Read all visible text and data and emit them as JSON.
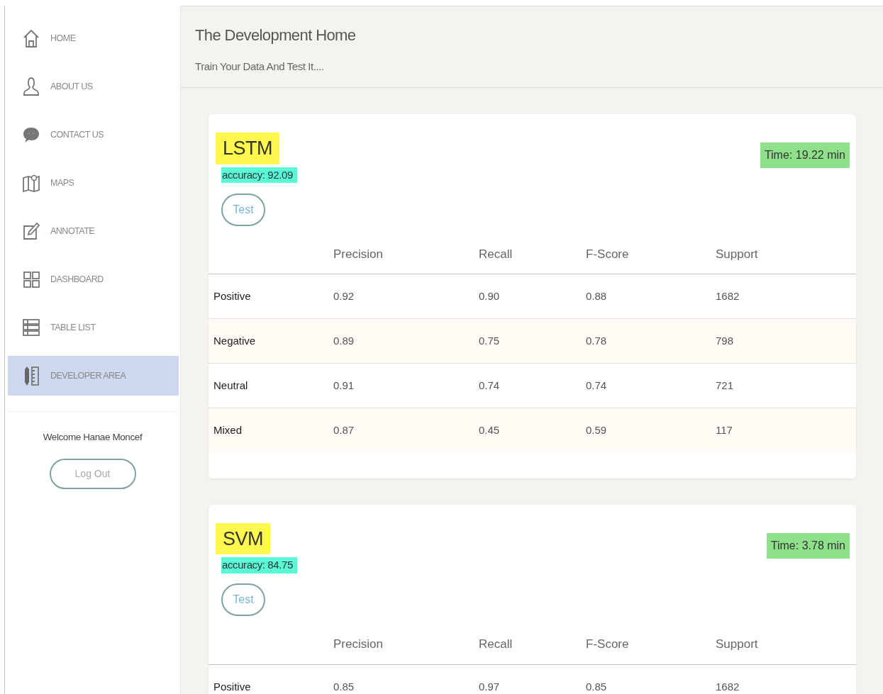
{
  "sidebar": {
    "items": [
      {
        "label": "HOME",
        "selected": false
      },
      {
        "label": "ABOUT US",
        "selected": false
      },
      {
        "label": "CONTACT US",
        "selected": false
      },
      {
        "label": "MAPS",
        "selected": false
      },
      {
        "label": "ANNOTATE",
        "selected": false
      },
      {
        "label": "DASHBOARD",
        "selected": false
      },
      {
        "label": "TABLE LIST",
        "selected": false
      },
      {
        "label": "DEVELOPER AREA",
        "selected": true
      }
    ],
    "welcome": "Welcome Hanae Moncef",
    "logout": "Log Out"
  },
  "header": {
    "title": "The Development Home",
    "subtitle": "Train Your Data And Test It...."
  },
  "models": [
    {
      "name": "LSTM",
      "accuracy": "accuracy: 92.09",
      "time": "Time: 19.22 min",
      "button": "Test",
      "columns": [
        "",
        "Precision",
        "Recall",
        "F-Score",
        "Support"
      ],
      "rows": [
        [
          "Positive",
          "0.92",
          "0.90",
          "0.88",
          "1682"
        ],
        [
          "Negative",
          "0.89",
          "0.75",
          "0.78",
          "798"
        ],
        [
          "Neutral",
          "0.91",
          "0.74",
          "0.74",
          "721"
        ],
        [
          "Mixed",
          "0.87",
          "0.45",
          "0.59",
          "117"
        ]
      ]
    },
    {
      "name": "SVM",
      "accuracy": "accuracy: 84.75",
      "time": "Time: 3.78 min",
      "button": "Test",
      "columns": [
        "",
        "Precision",
        "Recall",
        "F-Score",
        "Support"
      ],
      "rows": [
        [
          "Positive",
          "0.85",
          "0.97",
          "0.85",
          "1682"
        ]
      ]
    }
  ]
}
